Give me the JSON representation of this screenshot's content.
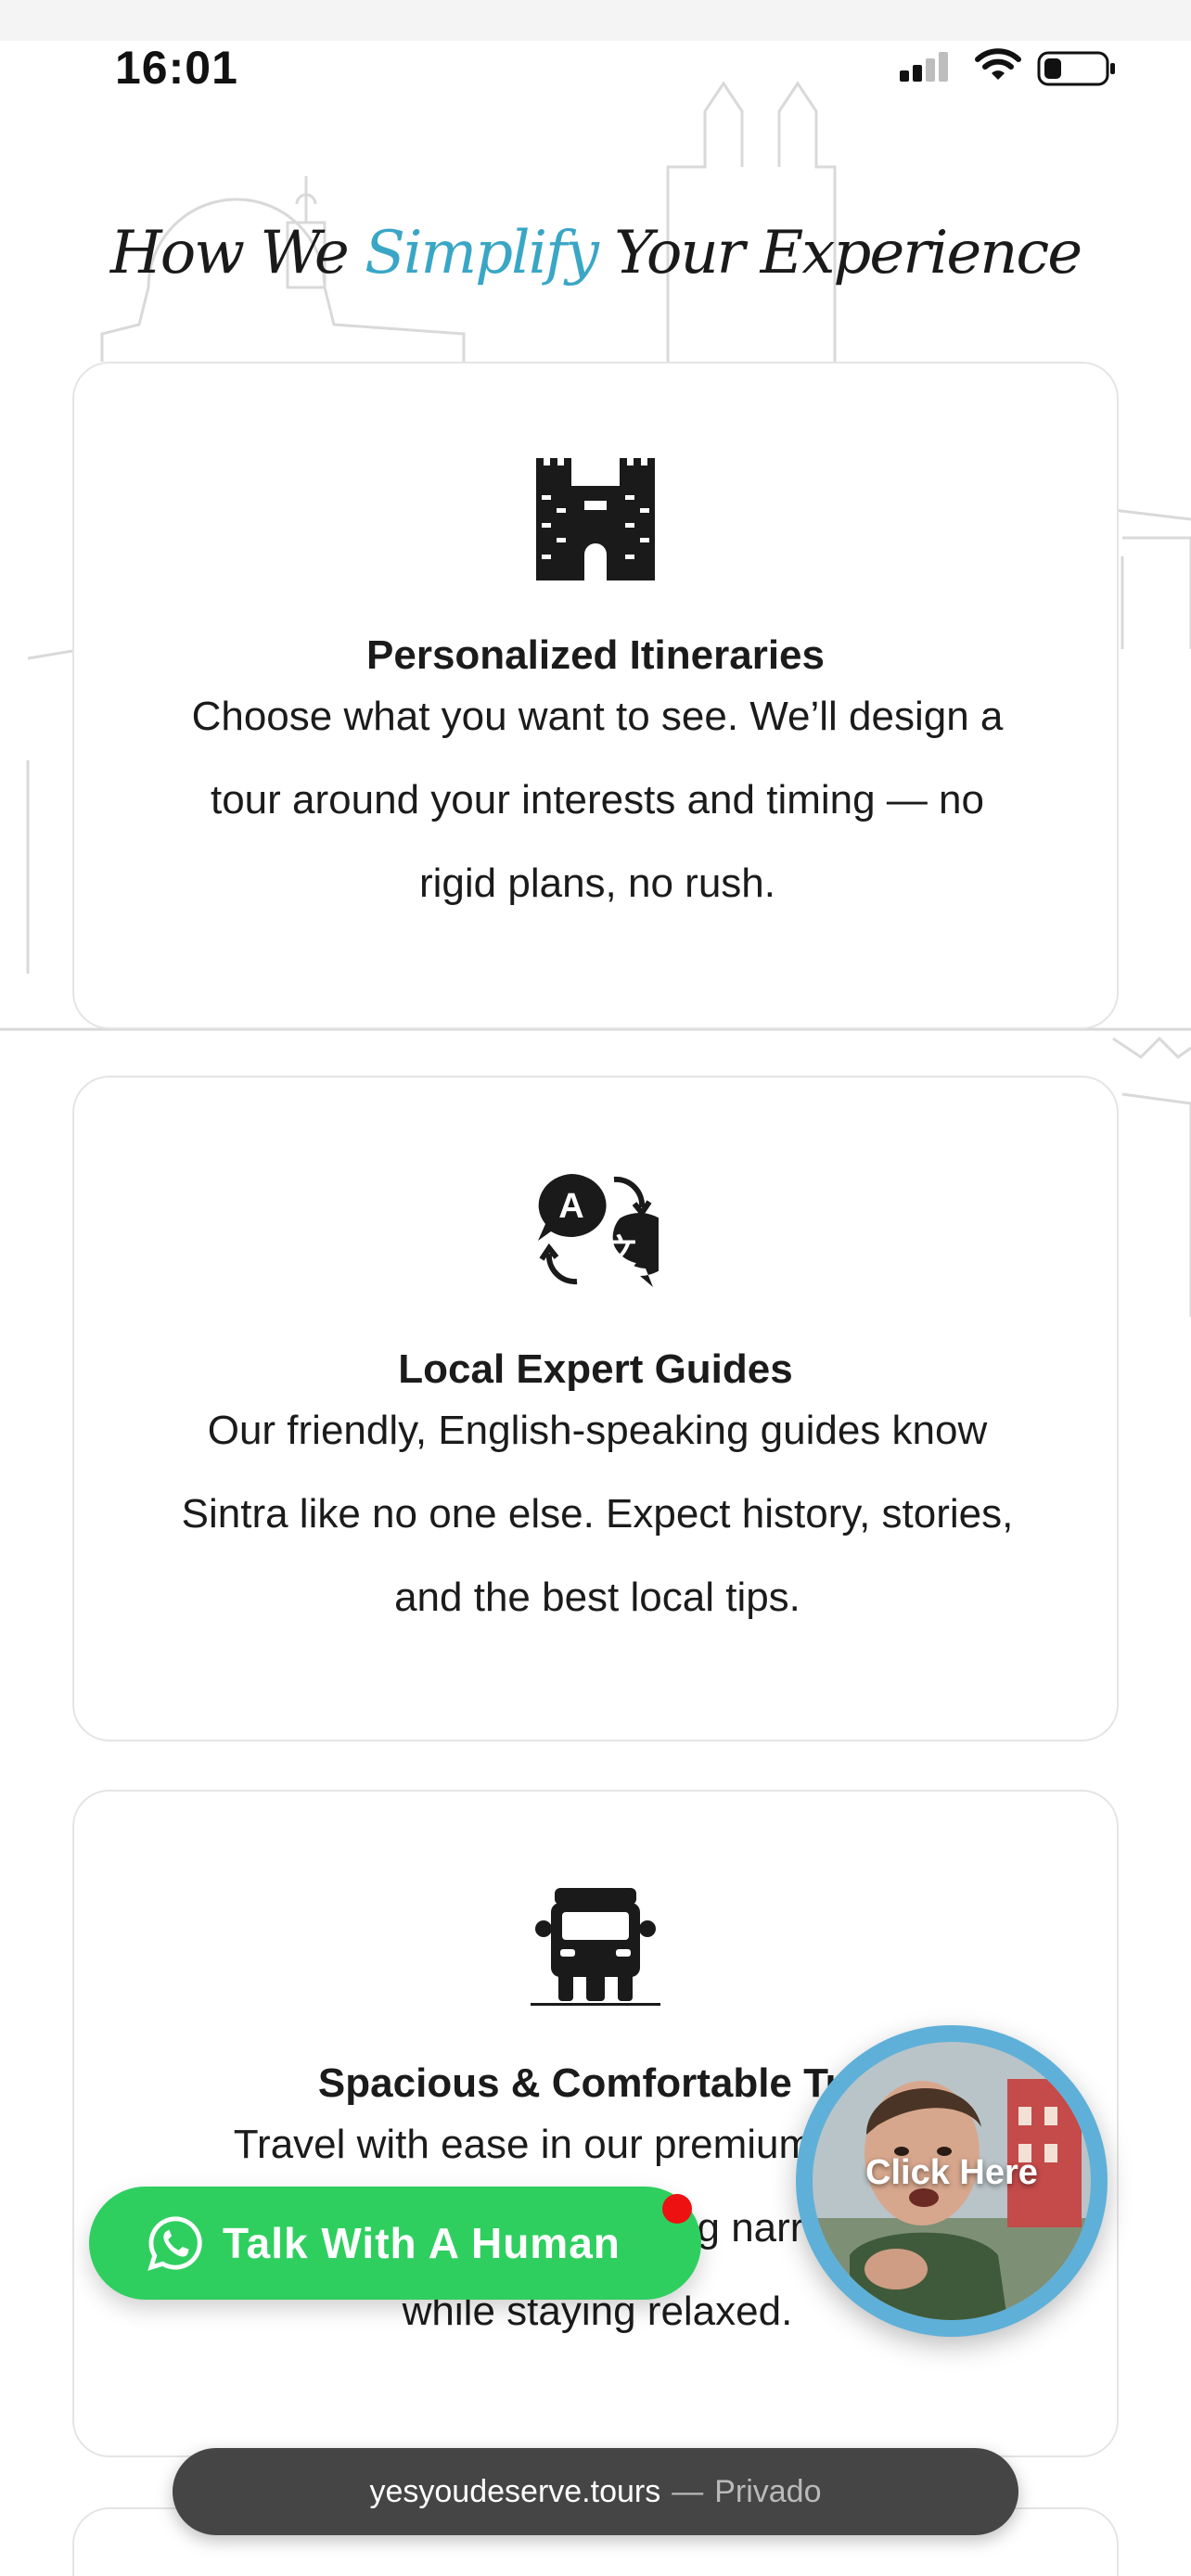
{
  "status_bar": {
    "time": "16:01"
  },
  "section": {
    "title_before": "How We ",
    "title_accent": "Simplify",
    "title_after": " Your Experience",
    "accent_color": "#3aa6c6"
  },
  "cards": [
    {
      "icon": "castle-icon",
      "title": "Personalized Itineraries",
      "lines": [
        "Choose what you want to see. We’ll design a",
        "tour around your interests and timing — no",
        "rigid plans, no rush."
      ]
    },
    {
      "icon": "translate-icon",
      "title": "Local Expert Guides",
      "lines": [
        "Our friendly, English-speaking guides know",
        "Sintra like no one else. Expect history, stories,",
        "and the best local tips."
      ]
    },
    {
      "icon": "tuk-tuk-icon",
      "title": "Spacious & Comfortable Tuk",
      "lines": [
        "Travel with ease in our premium",
        "g narr",
        "while staying relaxed."
      ]
    }
  ],
  "whatsapp": {
    "label": "Talk With A Human",
    "color": "#2ecf5f",
    "icon": "whatsapp-icon"
  },
  "video_bubble": {
    "label": "Click Here"
  },
  "url_bar": {
    "host": "yesyoudeserve.tours",
    "separator": "—",
    "mode": "Privado"
  }
}
